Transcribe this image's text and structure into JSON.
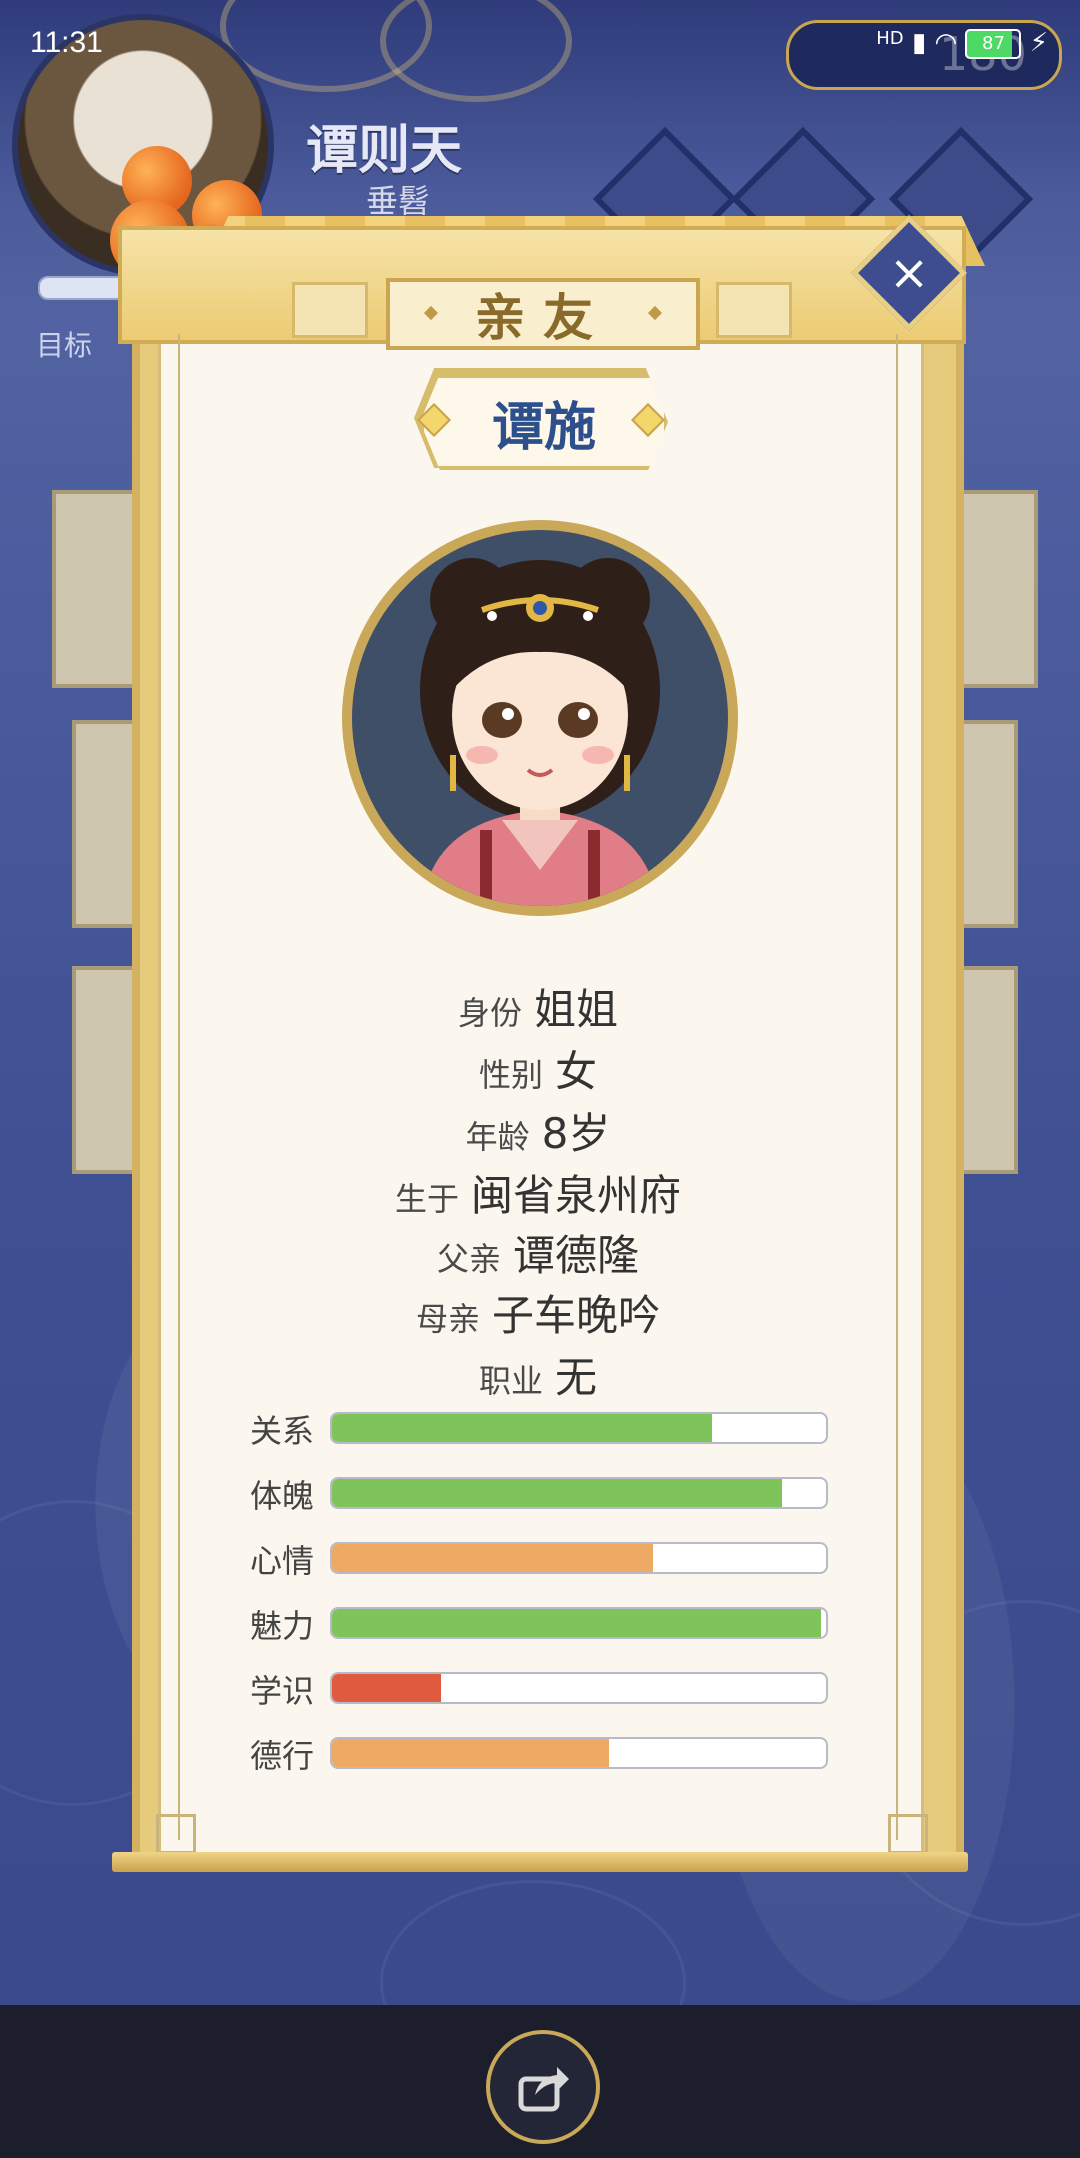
{
  "status_bar": {
    "time": "11:31",
    "network": "HD",
    "battery": "87"
  },
  "player": {
    "name": "谭则天",
    "subtitle": "垂髫",
    "target_label": "目标",
    "coin_hint": "180"
  },
  "dialog": {
    "title": "亲友",
    "close_icon": "close-icon"
  },
  "character": {
    "name": "谭施",
    "info": [
      {
        "key": "身份",
        "value": "姐姐"
      },
      {
        "key": "性别",
        "value": "女"
      },
      {
        "key": "年龄",
        "value": "8岁"
      },
      {
        "key": "生于",
        "value": "闽省泉州府"
      },
      {
        "key": "父亲",
        "value": "谭德隆"
      },
      {
        "key": "母亲",
        "value": "子车晚吟"
      },
      {
        "key": "职业",
        "value": "无"
      }
    ],
    "stats": [
      {
        "label": "关系",
        "fraction": 0.77,
        "color": "#7ec45a"
      },
      {
        "label": "体魄",
        "fraction": 0.91,
        "color": "#7ec45a"
      },
      {
        "label": "心情",
        "fraction": 0.65,
        "color": "#eeaa64"
      },
      {
        "label": "魅力",
        "fraction": 0.99,
        "color": "#7ec45a"
      },
      {
        "label": "学识",
        "fraction": 0.22,
        "color": "#e05a40"
      },
      {
        "label": "德行",
        "fraction": 0.56,
        "color": "#eeaa64"
      }
    ]
  },
  "bottom": {
    "share_icon": "share-icon"
  }
}
